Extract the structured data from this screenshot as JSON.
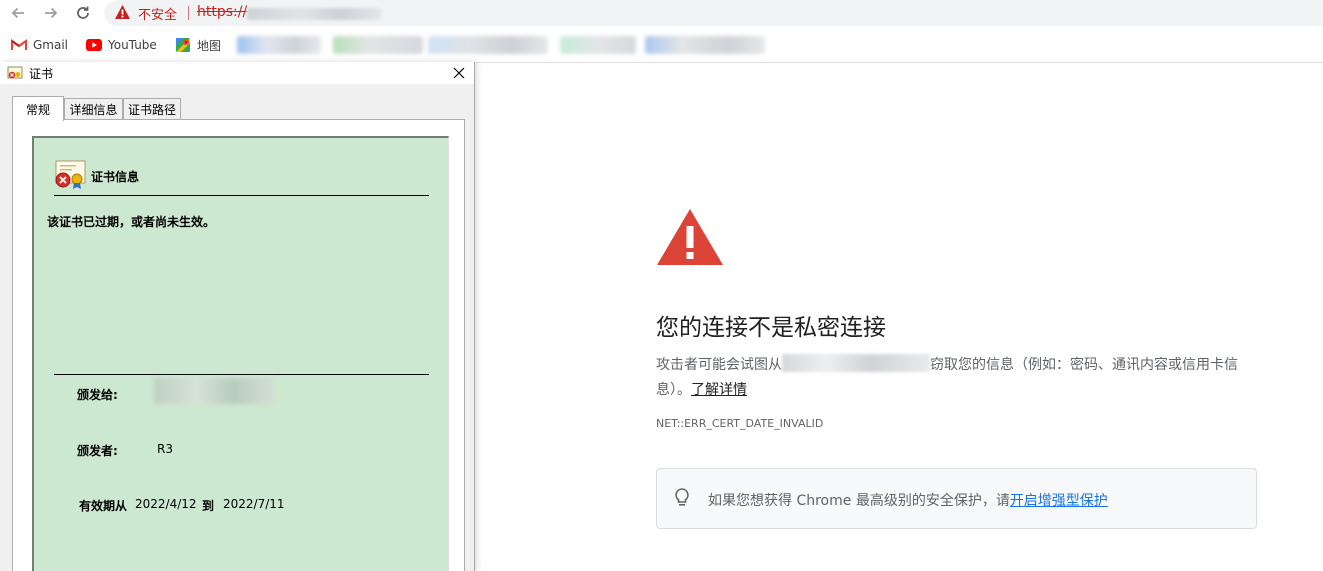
{
  "browser": {
    "security_label": "不安全",
    "url_scheme": "https://",
    "bookmarks": [
      {
        "label": "Gmail",
        "icon": "gmail-icon"
      },
      {
        "label": "YouTube",
        "icon": "youtube-icon"
      },
      {
        "label": "地图",
        "icon": "maps-icon"
      }
    ],
    "colors": {
      "warning": "#c5221f",
      "link": "#1a73e8",
      "cert_bg": "#cde8d1"
    }
  },
  "dialog": {
    "title": "证书",
    "tabs": [
      {
        "label": "常规",
        "active": true
      },
      {
        "label": "详细信息",
        "active": false
      },
      {
        "label": "证书路径",
        "active": false
      }
    ],
    "cert_info_title": "证书信息",
    "status_message": "该证书已过期，或者尚未生效。",
    "issued_to_label": "颁发给:",
    "issued_by_label": "颁发者:",
    "issued_by_value": "R3",
    "valid_from_label": "有效期从",
    "valid_from_value": "2022/4/12",
    "valid_to_label": "到",
    "valid_to_value": "2022/7/11"
  },
  "interstitial": {
    "title": "您的连接不是私密连接",
    "body_prefix": "攻击者可能会试图从",
    "body_suffix": "窃取您的信息（例如：密码、通讯内容或信用卡信息）。",
    "learn_more": "了解详情",
    "error_code": "NET::ERR_CERT_DATE_INVALID",
    "enhanced_text": "如果您想获得 Chrome 最高级别的安全保护，请",
    "enhanced_link": "开启增强型保护"
  }
}
